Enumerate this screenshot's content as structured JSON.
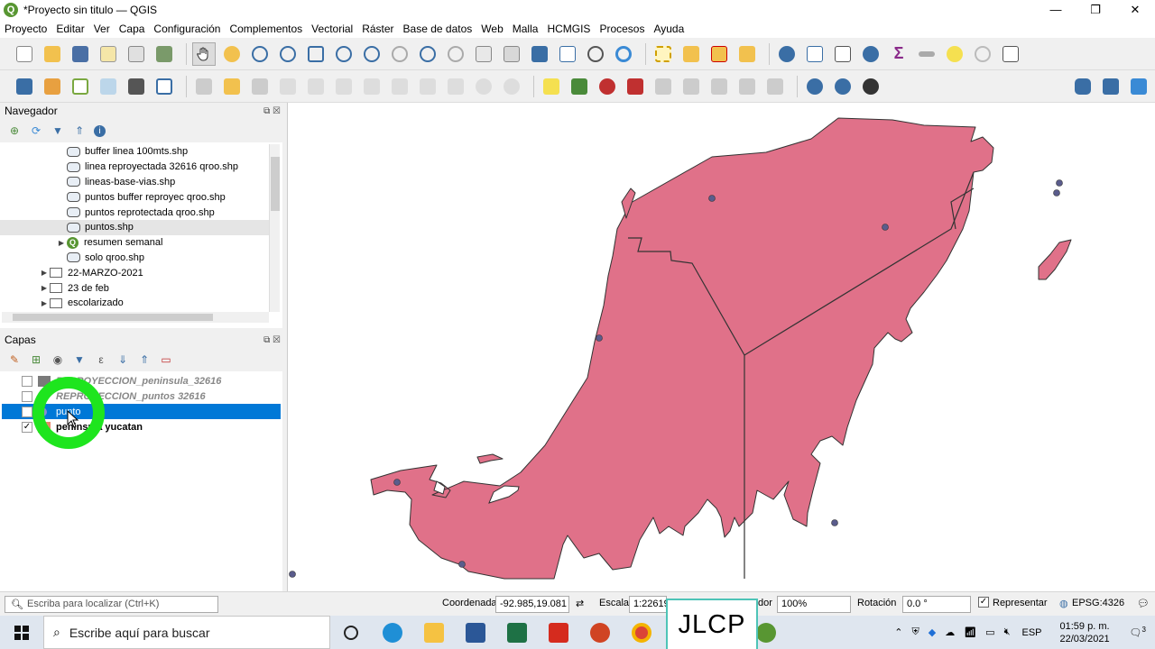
{
  "window": {
    "title": "*Proyecto sin titulo — QGIS",
    "app_icon": "Q",
    "controls": [
      "—",
      "❐",
      "✕"
    ]
  },
  "menu": [
    "Proyecto",
    "Editar",
    "Ver",
    "Capa",
    "Configuración",
    "Complementos",
    "Vectorial",
    "Ráster",
    "Base de datos",
    "Web",
    "Malla",
    "HCMGIS",
    "Procesos",
    "Ayuda"
  ],
  "navegador": {
    "title": "Navegador",
    "items": [
      {
        "label": "buffer linea 100mts.shp",
        "type": "file",
        "level": 2
      },
      {
        "label": "linea reproyectada 32616 qroo.shp",
        "type": "file",
        "level": 2
      },
      {
        "label": "lineas-base-vias.shp",
        "type": "file",
        "level": 2
      },
      {
        "label": "puntos buffer reproyec qroo.shp",
        "type": "file",
        "level": 2
      },
      {
        "label": "puntos reprotectada qroo.shp",
        "type": "file",
        "level": 2
      },
      {
        "label": "puntos.shp",
        "type": "file",
        "level": 2
      },
      {
        "label": "resumen semanal",
        "type": "project",
        "level": 2
      },
      {
        "label": "solo qroo.shp",
        "type": "file",
        "level": 2
      },
      {
        "label": "22-MARZO-2021",
        "type": "folder",
        "level": 1
      },
      {
        "label": "23 de feb",
        "type": "folder",
        "level": 1
      },
      {
        "label": "escolarizado",
        "type": "folder",
        "level": 1
      }
    ]
  },
  "capas": {
    "title": "Capas",
    "items": [
      {
        "label": "REPROYECCION_peninsula_32616",
        "checked": false,
        "style": "dim",
        "color": "#7a7a7a"
      },
      {
        "label": "REPROYECCION_puntos 32616",
        "checked": false,
        "style": "dim",
        "color": "#c9a46b"
      },
      {
        "label": "punto",
        "checked": true,
        "style": "selected",
        "color": "#8d8ad0"
      },
      {
        "label": "peninsula yucatan",
        "checked": true,
        "style": "bold",
        "color": "#e8866c"
      }
    ]
  },
  "map": {
    "fill": "#e07189",
    "stroke": "#333333",
    "point_color": "#5a5c8c"
  },
  "status": {
    "search_placeholder": "Escriba para localizar (Ctrl+K)",
    "coord_label": "Coordenada",
    "coord_value": "-92.985,19.081",
    "scale_label": "Escala",
    "scale_value": "1:22619",
    "magnifier_label": "dor",
    "magnifier_value": "100%",
    "rotation_label": "Rotación",
    "rotation_value": "0.0 °",
    "render_label": "Representar",
    "crs": "EPSG:4326"
  },
  "taskbar": {
    "search_text": "Escribe aquí para buscar",
    "lang": "ESP",
    "time": "01:59 p. m.",
    "date": "22/03/2021",
    "notifications": "3"
  },
  "watermark": "JLCP"
}
